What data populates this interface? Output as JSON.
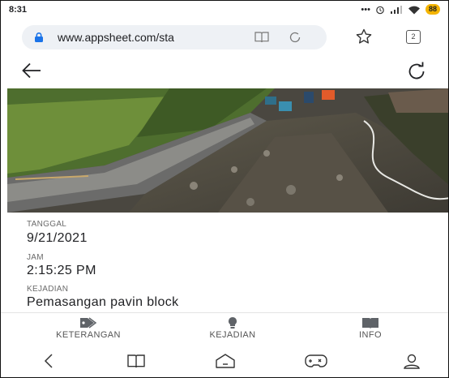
{
  "status_bar": {
    "time": "8:31",
    "icons": [
      "more-dots",
      "alarm-icon",
      "signal-icon",
      "wifi-icon"
    ],
    "battery": "88"
  },
  "browser": {
    "url": "www.appsheet.com/sta",
    "tab_count": "2"
  },
  "details": {
    "tanggal_label": "TANGGAL",
    "tanggal_value": "9/21/2021",
    "jam_label": "JAM",
    "jam_value": "2:15:25 PM",
    "kejadian_label": "KEJADIAN",
    "kejadian_value": "Pemasangan pavin block"
  },
  "bottom_nav": [
    {
      "label": "KETERANGAN",
      "icon": "tag-icon"
    },
    {
      "label": "KEJADIAN",
      "icon": "lightbulb-icon"
    },
    {
      "label": "INFO",
      "icon": "book-icon"
    }
  ],
  "colors": {
    "accent": "#1a73e8",
    "battery": "#f4b400",
    "icon_gray": "#5f6368"
  }
}
